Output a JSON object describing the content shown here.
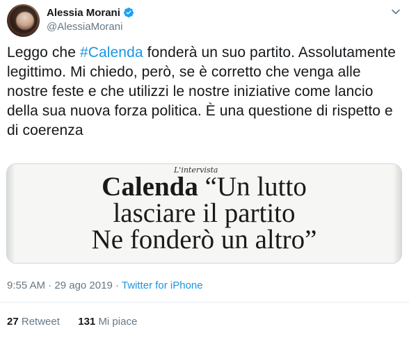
{
  "author": {
    "name": "Alessia Morani",
    "handle": "@AlessiaMorani",
    "verified_icon": "verified-badge-icon",
    "accent": "#1da1f2"
  },
  "tweet": {
    "text_before_hashtag": "Leggo che ",
    "hashtag": "#Calenda",
    "text_after_hashtag": " fonderà un suo partito. Assolutamente legittimo. Mi chiedo, però, se è corretto che venga alle nostre feste e che utilizzi le nostre iniziative come lancio della sua nuova forza politica. È una questione di rispetto e di coerenza",
    "hashtag_color": "#1b95e0"
  },
  "media": {
    "kicker": "L'intervista",
    "headline_bold": "Calenda",
    "headline_line1_rest": " “Un lutto",
    "headline_line2": "lasciare il partito",
    "headline_line3": "Ne fonderò un altro”"
  },
  "meta": {
    "time": "9:55 AM",
    "date": "29 ago 2019",
    "separator": "·",
    "source": "Twitter for iPhone"
  },
  "stats": {
    "retweets_count": "27",
    "retweets_label": "Retweet",
    "likes_count": "131",
    "likes_label": "Mi piace"
  },
  "icons": {
    "menu": "chevron-down-icon"
  }
}
